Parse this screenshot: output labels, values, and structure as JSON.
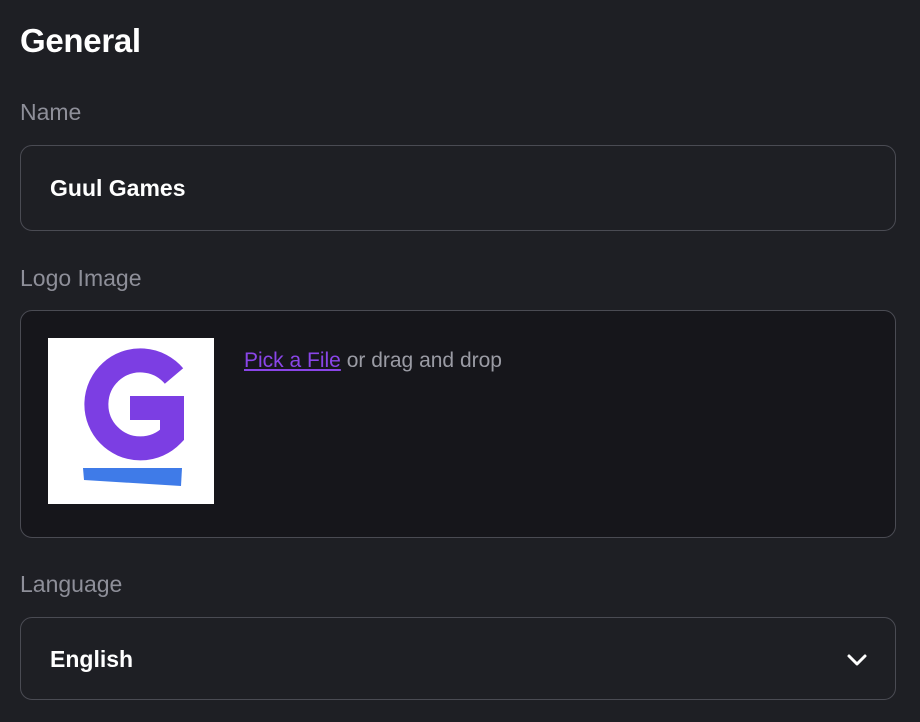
{
  "section": {
    "title": "General"
  },
  "name_field": {
    "label": "Name",
    "value": "Guul Games"
  },
  "logo_field": {
    "label": "Logo Image",
    "pick_link": "Pick a File",
    "drop_text": " or drag and drop",
    "logo_letter_color": "#7c3ee3",
    "logo_bar_color": "#3f7be8"
  },
  "language_field": {
    "label": "Language",
    "selected": "English",
    "icon": "chevron-down-icon"
  },
  "colors": {
    "background": "#1e1f24",
    "border": "#4a4b53",
    "label": "#8e8f99",
    "link": "#8a45e8"
  }
}
